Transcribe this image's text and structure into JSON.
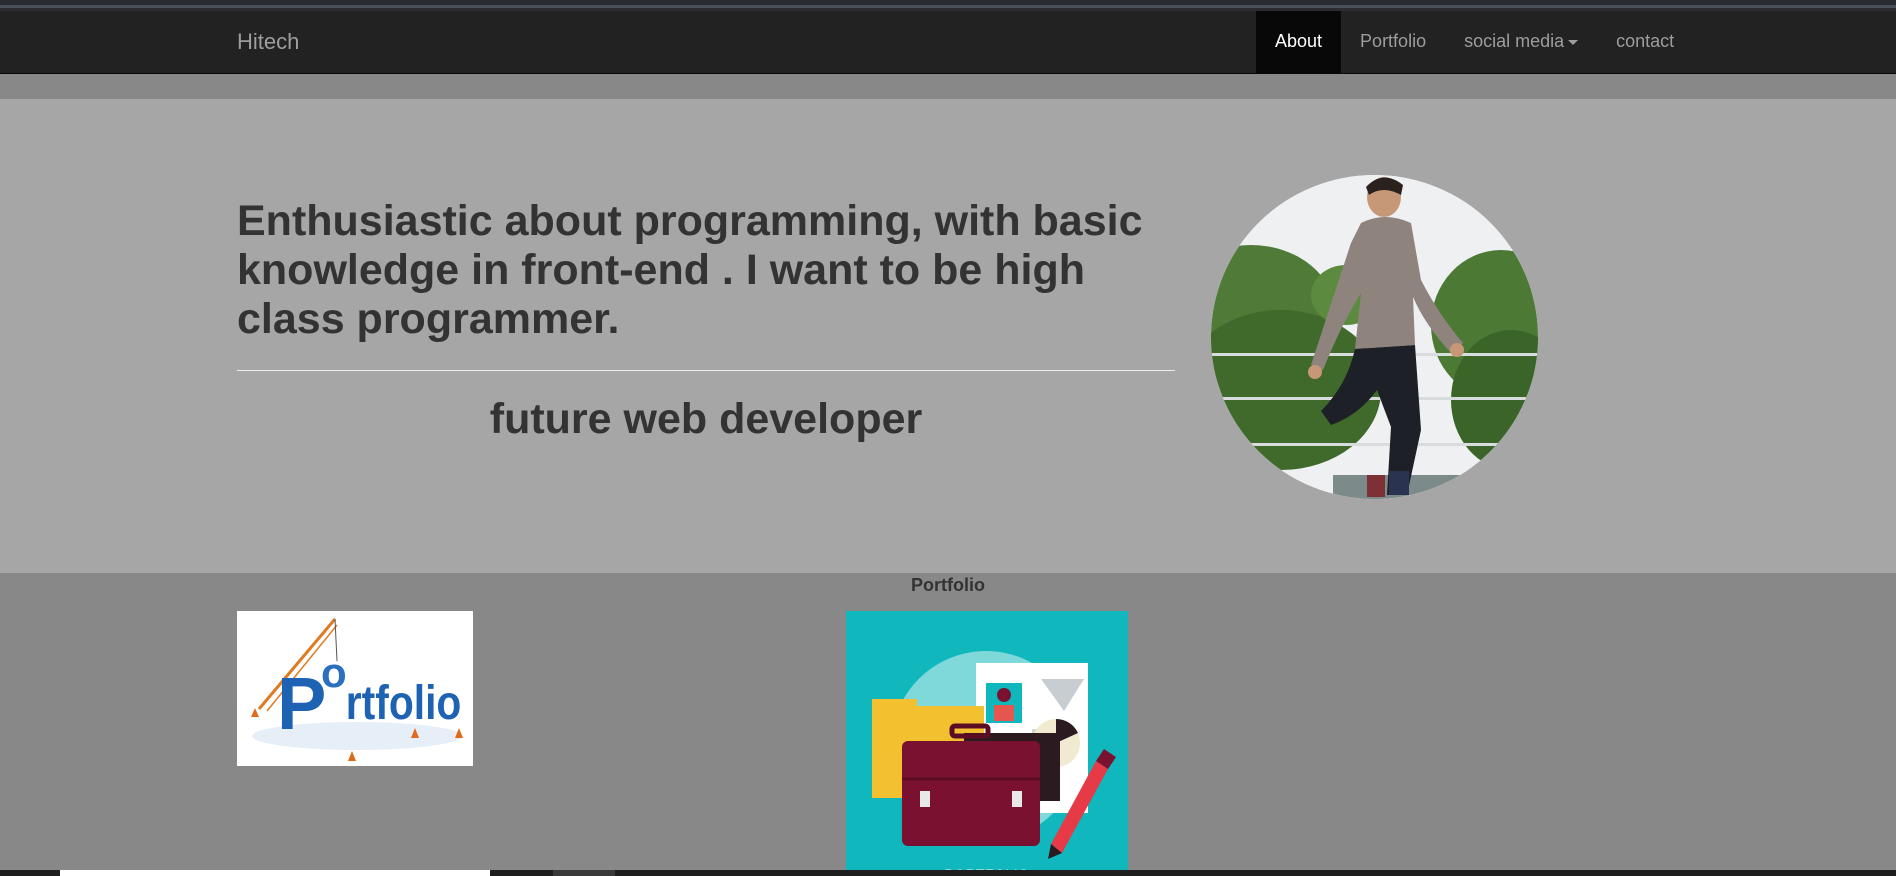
{
  "navbar": {
    "brand": "Hitech",
    "items": [
      {
        "label": "About",
        "active": true
      },
      {
        "label": "Portfolio",
        "active": false
      },
      {
        "label": "social media",
        "active": false,
        "dropdown": true
      },
      {
        "label": "contact",
        "active": false
      }
    ]
  },
  "hero": {
    "headline": "Enthusiastic about programming, with basic knowledge in front-end . I want to be high class programmer.",
    "subtitle": "future web developer"
  },
  "portfolio": {
    "heading": "Portfolio",
    "images": [
      {
        "alt": "Portfolio 3D lettering with crane"
      },
      {
        "alt": "Portfolio briefcase and documents illustration",
        "caption": "PORTFOLIO"
      }
    ]
  },
  "colors": {
    "navbar_bg": "#222222",
    "nav_active_bg": "#080808",
    "hero_bg": "#a6a6a6",
    "page_bg": "#888888",
    "text_dark": "#333333",
    "portfolio_teal": "#10b7bd",
    "briefcase": "#7a1130"
  }
}
